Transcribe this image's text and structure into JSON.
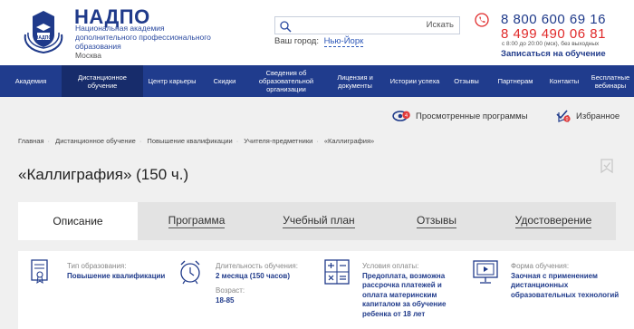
{
  "header": {
    "logo_title": "НАДПО",
    "logo_sub": "Национальная академия дополнительного профессионального образования",
    "logo_city": "Москва",
    "search_placeholder": "",
    "search_button": "Искать",
    "city_label": "Ваш город:",
    "city_value": "Нью-Йорк",
    "phone1": "8 800 600 69 16",
    "phone2": "8 499 490 06 81",
    "hours": "с 8:00 до 20:00 (мск), без выходных",
    "signup": "Записаться на обучение"
  },
  "nav": {
    "items": [
      {
        "label": "Академия",
        "active": false
      },
      {
        "label": "Дистанционное обучение",
        "active": true
      },
      {
        "label": "Центр карьеры",
        "active": false
      },
      {
        "label": "Скидки",
        "active": false
      },
      {
        "label": "Сведения об образовательной организации",
        "active": false
      },
      {
        "label": "Лицензия и документы",
        "active": false
      },
      {
        "label": "Истории успеха",
        "active": false
      },
      {
        "label": "Отзывы",
        "active": false
      },
      {
        "label": "Партнерам",
        "active": false
      },
      {
        "label": "Контакты",
        "active": false
      },
      {
        "label": "Бесплатные вебинары",
        "active": false
      }
    ]
  },
  "toolbar": {
    "viewed_label": "Просмотренные программы",
    "viewed_count": "4",
    "favorites_label": "Избранное",
    "favorites_count": "0"
  },
  "breadcrumb": [
    "Главная",
    "Дистанционное обучение",
    "Повышение квалификации",
    "Учителя-предметники",
    "«Каллиграфия»"
  ],
  "page_title": "«Каллиграфия» (150 ч.)",
  "tabs": [
    {
      "label": "Описание",
      "active": true
    },
    {
      "label": "Программа",
      "active": false
    },
    {
      "label": "Учебный план",
      "active": false
    },
    {
      "label": "Отзывы",
      "active": false
    },
    {
      "label": "Удостоверение",
      "active": false
    }
  ],
  "info": {
    "type_label": "Тип образования:",
    "type_value": "Повышение квалификации",
    "duration_label": "Длительность обучения:",
    "duration_value": "2 месяца (150 часов)",
    "age_label": "Возраст:",
    "age_value": "18-85",
    "payment_label": "Условия оплаты:",
    "payment_value": "Предоплата, возможна рассрочка платежей и оплата материнским капиталом за обучение ребенка от 18 лет",
    "form_label": "Форма обучения:",
    "form_value": "Заочная с применением дистанционных образовательных технологий"
  },
  "colors": {
    "brand_blue": "#203c8d",
    "nav_active": "#172c6b",
    "phone_red": "#e02a2a",
    "badge_red": "#e23b3b"
  }
}
